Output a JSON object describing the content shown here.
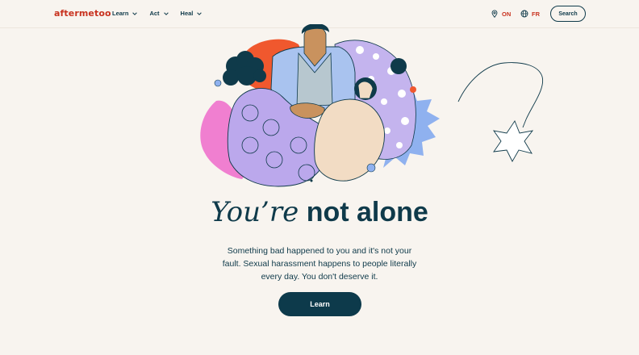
{
  "header": {
    "logo": "aftermetoo",
    "nav": [
      {
        "label": "Learn",
        "icon": "chevron-down-icon"
      },
      {
        "label": "Act",
        "icon": "chevron-down-icon"
      },
      {
        "label": "Heal",
        "icon": "chevron-down-icon"
      }
    ],
    "region": {
      "label": "ON",
      "icon": "location-pin-icon"
    },
    "language": {
      "label": "FR",
      "icon": "globe-icon"
    },
    "search_label": "Search"
  },
  "hero": {
    "headline_italic": "You’re",
    "headline_bold": "not alone",
    "subtitle": "Something bad happened to you and it's not your fault. Sexual harassment happens to people literally every day. You don't deserve it.",
    "cta_label": "Learn"
  },
  "colors": {
    "background": "#f8f4ef",
    "brand_red": "#c8321f",
    "navy": "#0f3a4a",
    "button": "#0d3a4b"
  }
}
